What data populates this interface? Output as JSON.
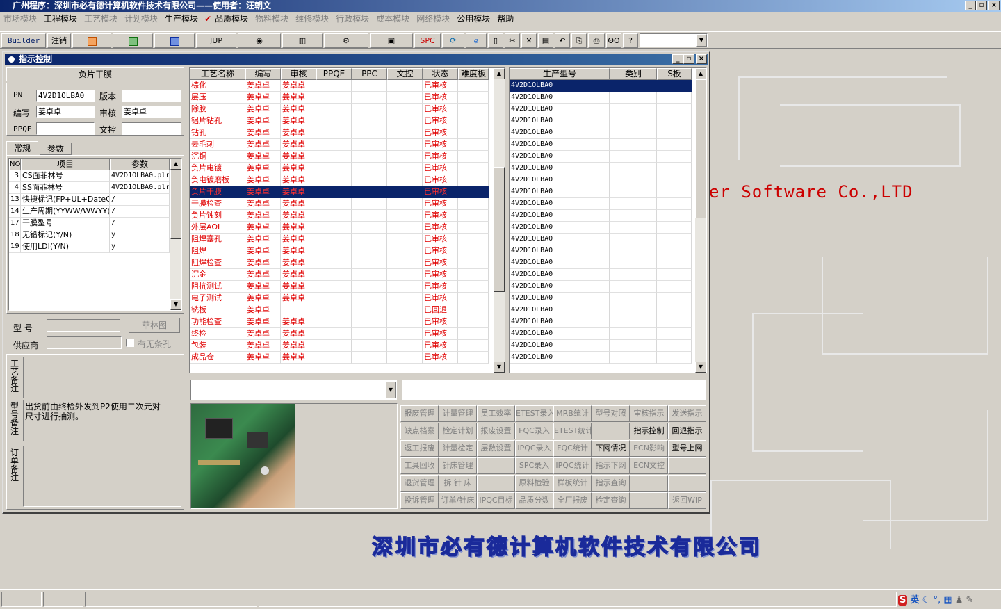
{
  "app_title": "广州程序：深圳市必有德计算机软件技术有限公司——使用者：汪朝文",
  "window_buttons": [
    "_",
    "▫",
    "×"
  ],
  "menus": [
    {
      "label": "市场模块",
      "enabled": false
    },
    {
      "label": "工程模块",
      "enabled": true
    },
    {
      "label": "工艺模块",
      "enabled": false
    },
    {
      "label": "计划模块",
      "enabled": false
    },
    {
      "label": "生产模块",
      "enabled": true
    },
    {
      "label": "品质模块",
      "enabled": true,
      "checked": true
    },
    {
      "label": "物料模块",
      "enabled": false
    },
    {
      "label": "维修模块",
      "enabled": false
    },
    {
      "label": "行政模块",
      "enabled": false
    },
    {
      "label": "成本模块",
      "enabled": false
    },
    {
      "label": "网络模块",
      "enabled": false
    },
    {
      "label": "公用模块",
      "enabled": true
    },
    {
      "label": "帮助",
      "enabled": true
    }
  ],
  "toolbar": {
    "builder": "Builder",
    "logout": "注销",
    "jup": "JUP",
    "spc": "SPC",
    "combo_arrow": "▼"
  },
  "brand_en": "er Software Co.,LTD",
  "brand_cn": "深圳市必有德计算机软件技术有限公司",
  "dialog": {
    "title": "指示控制",
    "process_name": "负片干膜",
    "pn_label": "PN",
    "pn_value": "4V2D1OLBA0",
    "version_label": "版本",
    "version_value": "",
    "writer_label": "编写",
    "writer_value": "姜卓卓",
    "reviewer_label": "审核",
    "reviewer_value": "姜卓卓",
    "ppqe_label": "PPQE",
    "ppqe_value": "",
    "dcc_label": "文控",
    "dcc_value": "",
    "tabs": [
      "常规",
      "参数"
    ],
    "param_headers": [
      "NO",
      "项目",
      "参数"
    ],
    "params": [
      {
        "no": "3",
        "item": "CS面菲林号",
        "value": "4V2D1OLBA0.plr"
      },
      {
        "no": "4",
        "item": "SS面菲林号",
        "value": "4V2D1OLBA0.plr"
      },
      {
        "no": "13",
        "item": "快捷标记(FP+UL+DateC",
        "value": "/"
      },
      {
        "no": "14",
        "item": "生产周期(YYWW/WWYY)",
        "value": "/"
      },
      {
        "no": "17",
        "item": "干膜型号",
        "value": "/"
      },
      {
        "no": "18",
        "item": "无铅标记(Y/N)",
        "value": "y"
      },
      {
        "no": "19",
        "item": "使用LDI(Y/N)",
        "value": "y"
      }
    ],
    "model_label": "型 号",
    "model_value": "",
    "film_button": "菲林图",
    "supplier_label": "供应商",
    "supplier_value": "",
    "hole_label": "有无条孔",
    "process_note_label": "工艺备注",
    "process_note": "",
    "model_note_label": "型号备注",
    "model_note": "出货前由终检外发到P2使用二次元对尺寸进行抽测。",
    "order_note_label": "订单备注",
    "order_note": "",
    "proc_headers": [
      "工艺名称",
      "编写",
      "审核",
      "PPQE",
      "PPC",
      "文控",
      "状态",
      "难度板"
    ],
    "procs": [
      {
        "name": "棕化",
        "w": "姜卓卓",
        "r": "姜卓卓",
        "s": "已审核"
      },
      {
        "name": "层压",
        "w": "姜卓卓",
        "r": "姜卓卓",
        "s": "已审核"
      },
      {
        "name": "除胶",
        "w": "姜卓卓",
        "r": "姜卓卓",
        "s": "已审核"
      },
      {
        "name": "铝片钻孔",
        "w": "姜卓卓",
        "r": "姜卓卓",
        "s": "已审核"
      },
      {
        "name": "钻孔",
        "w": "姜卓卓",
        "r": "姜卓卓",
        "s": "已审核"
      },
      {
        "name": "去毛刺",
        "w": "姜卓卓",
        "r": "姜卓卓",
        "s": "已审核"
      },
      {
        "name": "沉铜",
        "w": "姜卓卓",
        "r": "姜卓卓",
        "s": "已审核"
      },
      {
        "name": "负片电镀",
        "w": "姜卓卓",
        "r": "姜卓卓",
        "s": "已审核"
      },
      {
        "name": "负电镀磨板",
        "w": "姜卓卓",
        "r": "姜卓卓",
        "s": "已审核"
      },
      {
        "name": "负片干膜",
        "w": "姜卓卓",
        "r": "姜卓卓",
        "s": "已审核",
        "selected": true
      },
      {
        "name": "干膜检查",
        "w": "姜卓卓",
        "r": "姜卓卓",
        "s": "已审核"
      },
      {
        "name": "负片蚀刻",
        "w": "姜卓卓",
        "r": "姜卓卓",
        "s": "已审核"
      },
      {
        "name": "外层AOI",
        "w": "姜卓卓",
        "r": "姜卓卓",
        "s": "已审核"
      },
      {
        "name": "阻焊塞孔",
        "w": "姜卓卓",
        "r": "姜卓卓",
        "s": "已审核"
      },
      {
        "name": "阻焊",
        "w": "姜卓卓",
        "r": "姜卓卓",
        "s": "已审核"
      },
      {
        "name": "阻焊检查",
        "w": "姜卓卓",
        "r": "姜卓卓",
        "s": "已审核"
      },
      {
        "name": "沉金",
        "w": "姜卓卓",
        "r": "姜卓卓",
        "s": "已审核"
      },
      {
        "name": "阻抗测试",
        "w": "姜卓卓",
        "r": "姜卓卓",
        "s": "已审核"
      },
      {
        "name": "电子测试",
        "w": "姜卓卓",
        "r": "姜卓卓",
        "s": "已审核"
      },
      {
        "name": "铣板",
        "w": "姜卓卓",
        "r": "",
        "s": "已回退"
      },
      {
        "name": "功能检查",
        "w": "姜卓卓",
        "r": "姜卓卓",
        "s": "已审核"
      },
      {
        "name": "终检",
        "w": "姜卓卓",
        "r": "姜卓卓",
        "s": "已审核"
      },
      {
        "name": "包装",
        "w": "姜卓卓",
        "r": "姜卓卓",
        "s": "已审核"
      },
      {
        "name": "成品仓",
        "w": "姜卓卓",
        "r": "姜卓卓",
        "s": "已审核"
      }
    ],
    "model_headers": [
      "生产型号",
      "类别",
      "S板"
    ],
    "models": [
      "4V2D1OLBA0",
      "4V2D1OLBA0",
      "4V2D1OLBA0",
      "4V2D1OLBA0",
      "4V2D1OLBA0",
      "4V2D1OLBA0",
      "4V2D1OLBA0",
      "4V2D1OLBA0",
      "4V2D1OLBA0",
      "4V2D1OLBA0",
      "4V2D1OLBA0",
      "4V2D1OLBA0",
      "4V2D1OLBA0",
      "4V2D1OLBA0",
      "4V2D1OLBA0",
      "4V2D1OLBA0",
      "4V2D1OLBA0",
      "4V2D1OLBA0",
      "4V2D1OLBA0",
      "4V2D1OLBA0",
      "4V2D1OLBA0",
      "4V2D1OLBA0",
      "4V2D1OLBA0",
      "4V2D1OLBA0"
    ],
    "combo_value": "",
    "text_value": "",
    "buttons": [
      [
        "报废管理",
        "计量管理",
        "员工效率",
        "ETEST录入",
        "MRB统计",
        "型号对照",
        "审核指示",
        "发送指示"
      ],
      [
        "缺点档案",
        "检定计划",
        "报废设置",
        "FQC录入",
        "ETEST统计",
        "",
        "指示控制",
        "回退指示"
      ],
      [
        "返工报废",
        "计量检定",
        "层数设置",
        "IPQC录入",
        "FQC统计",
        "下网情况",
        "ECN影响",
        "型号上网"
      ],
      [
        "工具回收",
        "针床管理",
        "",
        "SPC录入",
        "IPQC统计",
        "指示下网",
        "ECN文控",
        ""
      ],
      [
        "退货管理",
        "拆 针 床",
        "",
        "原料检验",
        "样板统计",
        "指示查询",
        "",
        ""
      ],
      [
        "投诉管理",
        "订单/针床",
        "IPQC目标",
        "品质分数",
        "全厂报废",
        "检定查询",
        "",
        "返回WIP"
      ]
    ],
    "enabled_buttons": [
      "指示控制",
      "回退指示",
      "下网情况",
      "型号上网"
    ]
  },
  "tray": {
    "ime": "英",
    "icons": [
      "S",
      "☾",
      "°,",
      "▦",
      "♟",
      "✎"
    ]
  }
}
